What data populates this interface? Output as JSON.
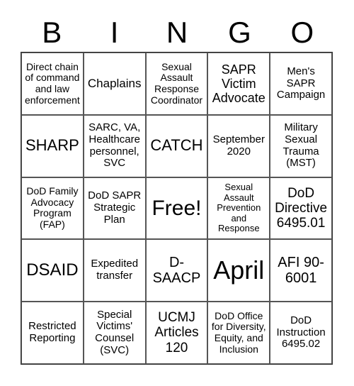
{
  "header": [
    "B",
    "I",
    "N",
    "G",
    "O"
  ],
  "cells": [
    [
      "Direct chain of command and law enforcement",
      "Chaplains",
      "Sexual Assault Response Coordinator",
      "SAPR Victim Advocate",
      "Men's SAPR Campaign"
    ],
    [
      "SHARP",
      "SARC, VA, Healthcare personnel, SVC",
      "CATCH",
      "September 2020",
      "Military Sexual Trauma (MST)"
    ],
    [
      "DoD Family Advocacy Program (FAP)",
      "DoD SAPR Strategic Plan",
      "Free!",
      "Sexual Assault Prevention and Response",
      "DoD Directive 6495.01"
    ],
    [
      "DSAID",
      "Expedited transfer",
      "D-SAACP",
      "April",
      "AFI 90-6001"
    ],
    [
      "Restricted Reporting",
      "Special Victims' Counsel (SVC)",
      "UCMJ Articles 120",
      "DoD Office for Diversity, Equity, and Inclusion",
      "DoD Instruction 6495.02"
    ]
  ]
}
